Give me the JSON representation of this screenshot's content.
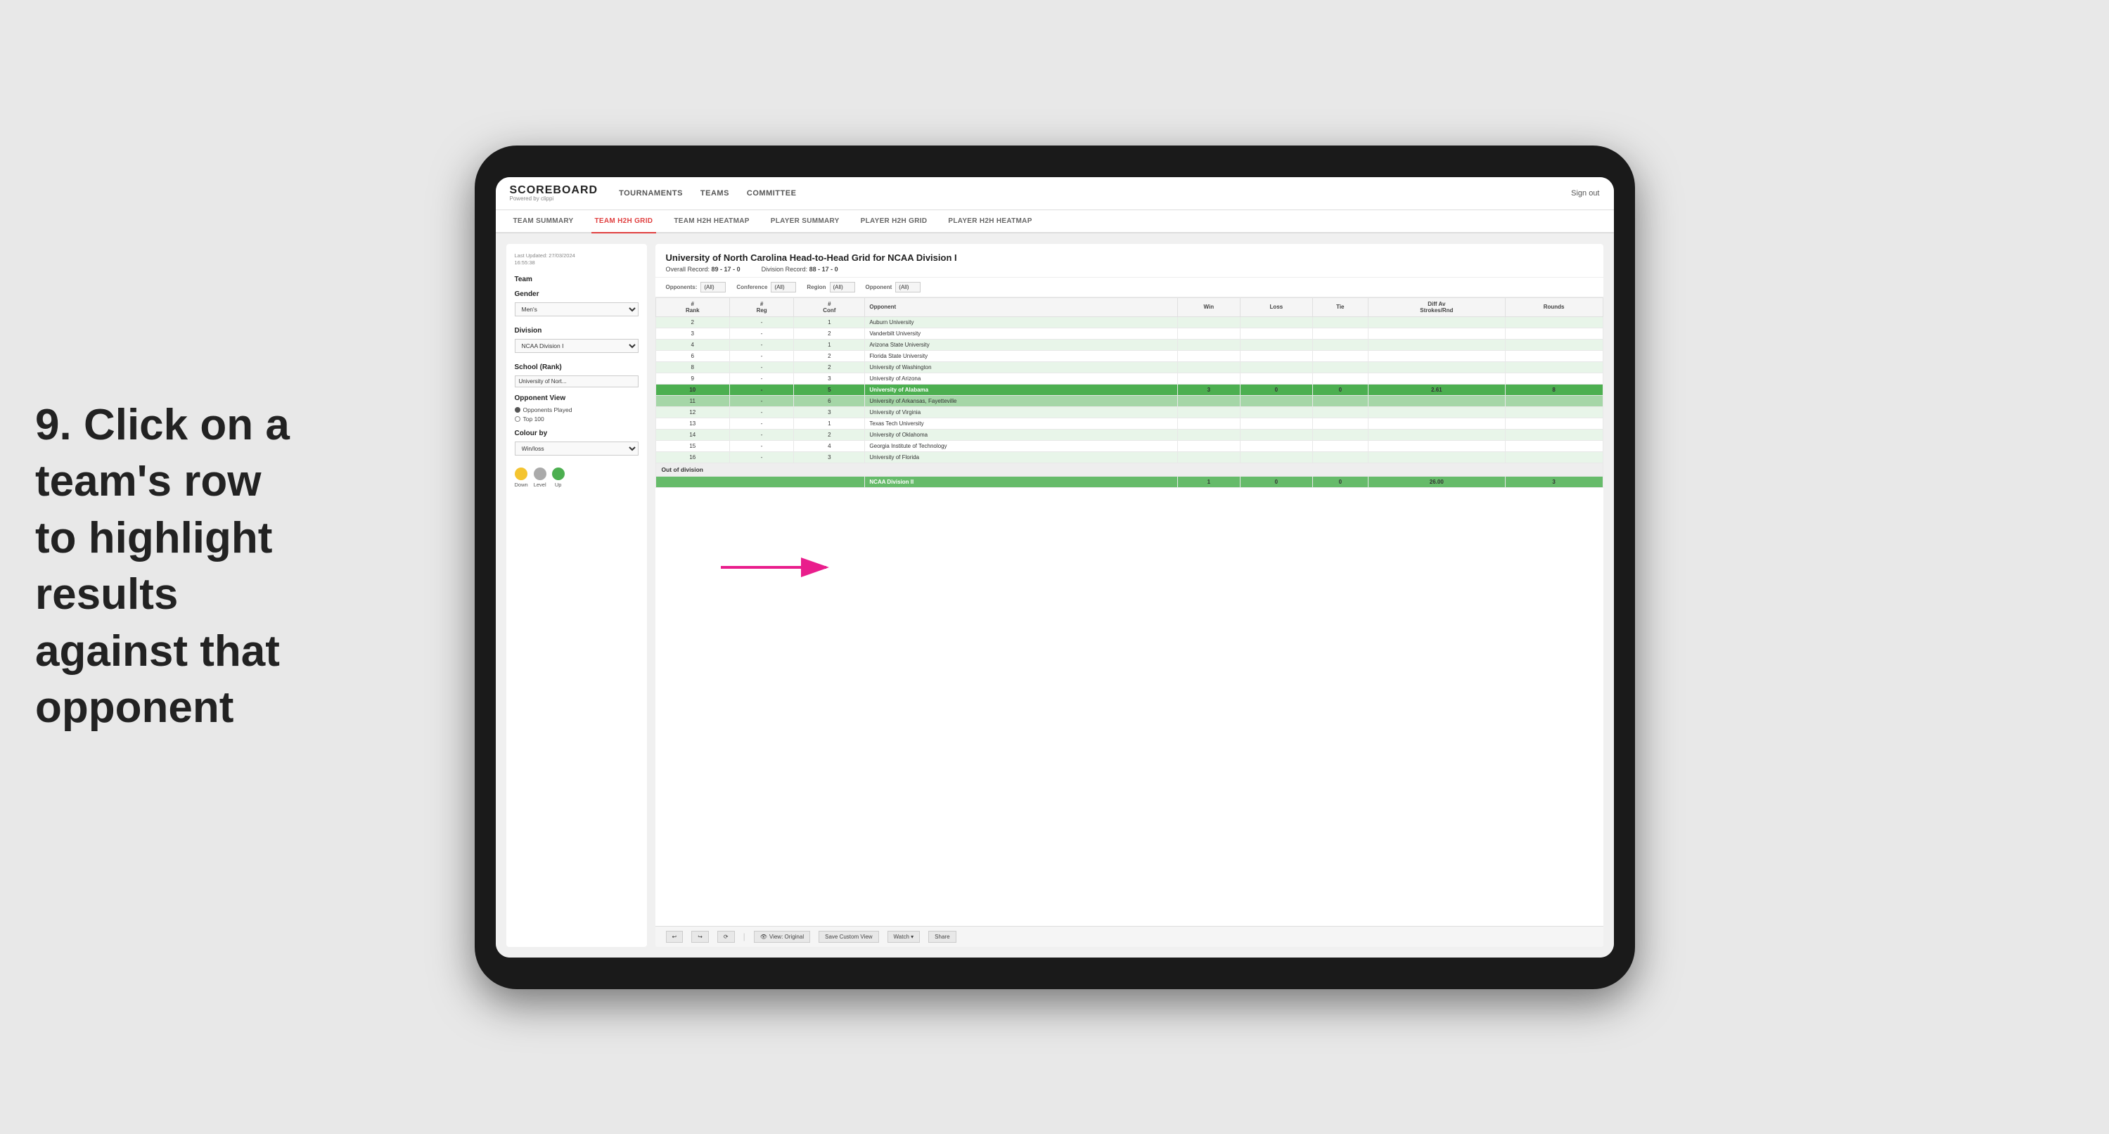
{
  "instruction": {
    "step": "9.",
    "text": "Click on a team's row to highlight results against that opponent"
  },
  "nav": {
    "logo": "SCOREBOARD",
    "logo_sub": "Powered by clippi",
    "items": [
      "TOURNAMENTS",
      "TEAMS",
      "COMMITTEE"
    ],
    "sign_out": "Sign out"
  },
  "sub_nav": {
    "items": [
      "TEAM SUMMARY",
      "TEAM H2H GRID",
      "TEAM H2H HEATMAP",
      "PLAYER SUMMARY",
      "PLAYER H2H GRID",
      "PLAYER H2H HEATMAP"
    ],
    "active": "TEAM H2H GRID"
  },
  "sidebar": {
    "timestamp_label": "Last Updated: 27/03/2024",
    "timestamp_time": "16:55:38",
    "team_label": "Team",
    "gender_label": "Gender",
    "gender_value": "Men's",
    "division_label": "Division",
    "division_value": "NCAA Division I",
    "school_label": "School (Rank)",
    "school_value": "University of Nort...",
    "opponent_view_label": "Opponent View",
    "opponent_played": "Opponents Played",
    "opponent_top100": "Top 100",
    "colour_label": "Colour by",
    "colour_value": "Win/loss",
    "legend": {
      "down_label": "Down",
      "level_label": "Level",
      "up_label": "Up",
      "down_color": "#f4c430",
      "level_color": "#aaaaaa",
      "up_color": "#4caf50"
    }
  },
  "panel": {
    "title": "University of North Carolina Head-to-Head Grid for NCAA Division I",
    "overall_record_label": "Overall Record:",
    "overall_record": "89 - 17 - 0",
    "division_record_label": "Division Record:",
    "division_record": "88 - 17 - 0",
    "filters": {
      "opponents_label": "Opponents:",
      "opponents_value": "(All)",
      "conference_label": "Conference",
      "conference_value": "(All)",
      "region_label": "Region",
      "region_value": "(All)",
      "opponent_label": "Opponent",
      "opponent_value": "(All)"
    },
    "table": {
      "headers": [
        "#\nRank",
        "#\nReg",
        "#\nConf",
        "Opponent",
        "Win",
        "Loss",
        "Tie",
        "Diff Av\nStrokes/Rnd",
        "Rounds"
      ],
      "rows": [
        {
          "rank": "2",
          "reg": "-",
          "conf": "1",
          "opponent": "Auburn University",
          "win": "",
          "loss": "",
          "tie": "",
          "diff": "",
          "rounds": "",
          "style": "light-green"
        },
        {
          "rank": "3",
          "reg": "-",
          "conf": "2",
          "opponent": "Vanderbilt University",
          "win": "",
          "loss": "",
          "tie": "",
          "diff": "",
          "rounds": "",
          "style": "normal"
        },
        {
          "rank": "4",
          "reg": "-",
          "conf": "1",
          "opponent": "Arizona State University",
          "win": "",
          "loss": "",
          "tie": "",
          "diff": "",
          "rounds": "",
          "style": "light-green"
        },
        {
          "rank": "6",
          "reg": "-",
          "conf": "2",
          "opponent": "Florida State University",
          "win": "",
          "loss": "",
          "tie": "",
          "diff": "",
          "rounds": "",
          "style": "normal"
        },
        {
          "rank": "8",
          "reg": "-",
          "conf": "2",
          "opponent": "University of Washington",
          "win": "",
          "loss": "",
          "tie": "",
          "diff": "",
          "rounds": "",
          "style": "light-green"
        },
        {
          "rank": "9",
          "reg": "-",
          "conf": "3",
          "opponent": "University of Arizona",
          "win": "",
          "loss": "",
          "tie": "",
          "diff": "",
          "rounds": "",
          "style": "normal"
        },
        {
          "rank": "10",
          "reg": "-",
          "conf": "5",
          "opponent": "University of Alabama",
          "win": "3",
          "loss": "0",
          "tie": "0",
          "diff": "2.61",
          "rounds": "8",
          "style": "selected"
        },
        {
          "rank": "11",
          "reg": "-",
          "conf": "6",
          "opponent": "University of Arkansas, Fayetteville",
          "win": "",
          "loss": "",
          "tie": "",
          "diff": "",
          "rounds": "",
          "style": "highlighted"
        },
        {
          "rank": "12",
          "reg": "-",
          "conf": "3",
          "opponent": "University of Virginia",
          "win": "",
          "loss": "",
          "tie": "",
          "diff": "",
          "rounds": "",
          "style": "light-green"
        },
        {
          "rank": "13",
          "reg": "-",
          "conf": "1",
          "opponent": "Texas Tech University",
          "win": "",
          "loss": "",
          "tie": "",
          "diff": "",
          "rounds": "",
          "style": "normal"
        },
        {
          "rank": "14",
          "reg": "-",
          "conf": "2",
          "opponent": "University of Oklahoma",
          "win": "",
          "loss": "",
          "tie": "",
          "diff": "",
          "rounds": "",
          "style": "light-green"
        },
        {
          "rank": "15",
          "reg": "-",
          "conf": "4",
          "opponent": "Georgia Institute of Technology",
          "win": "",
          "loss": "",
          "tie": "",
          "diff": "",
          "rounds": "",
          "style": "normal"
        },
        {
          "rank": "16",
          "reg": "-",
          "conf": "3",
          "opponent": "University of Florida",
          "win": "",
          "loss": "",
          "tie": "",
          "diff": "",
          "rounds": "",
          "style": "light-green"
        }
      ],
      "out_division_label": "Out of division",
      "out_division_row": {
        "label": "NCAA Division II",
        "win": "1",
        "loss": "0",
        "tie": "0",
        "diff": "26.00",
        "rounds": "3"
      }
    }
  },
  "toolbar": {
    "view_label": "View: Original",
    "save_label": "Save Custom View",
    "watch_label": "Watch ▾",
    "share_label": "Share"
  }
}
